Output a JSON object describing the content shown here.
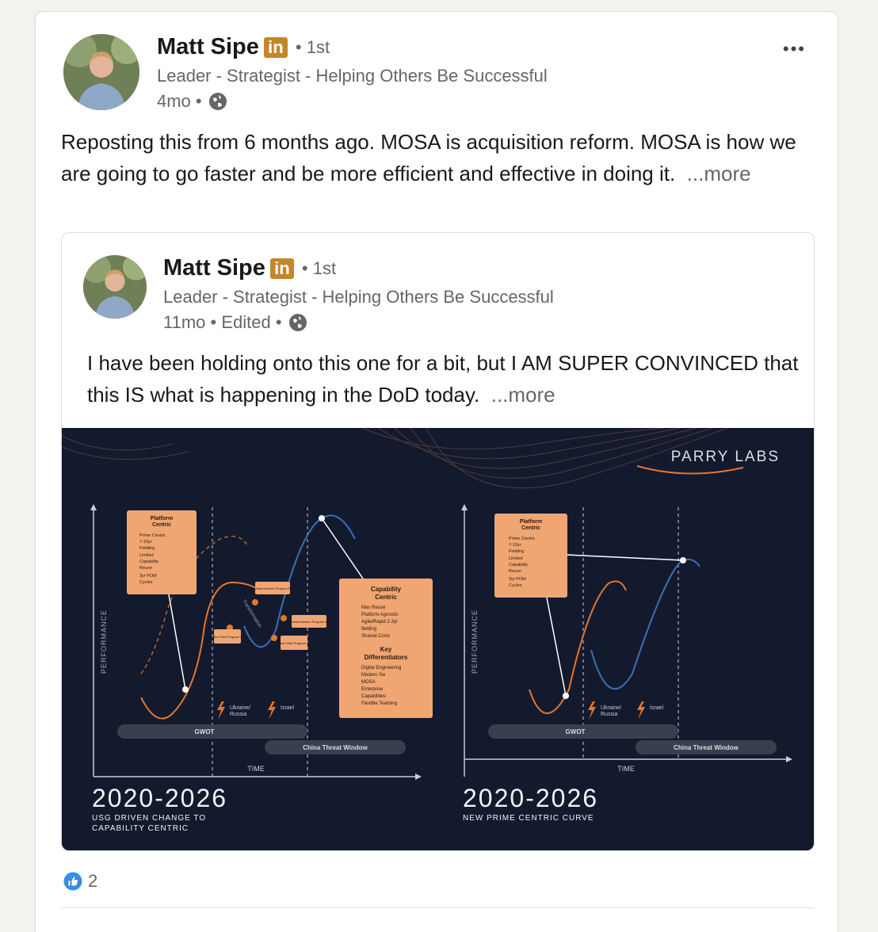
{
  "post": {
    "author": {
      "name": "Matt Sipe",
      "badge": "in",
      "degree": "• 1st",
      "headline": "Leader - Strategist - Helping Others Be Successful",
      "time": "4mo •"
    },
    "text": "Reposting this from 6 months ago. MOSA is acquisition reform. MOSA is how we are going to go faster and be more efficient and effective in doing it.",
    "see_more": "...more",
    "menu": "•••",
    "reaction_count": "2"
  },
  "repost": {
    "author": {
      "name": "Matt Sipe",
      "badge": "in",
      "degree": "• 1st",
      "headline": "Leader - Strategist - Helping Others Be Successful",
      "time": "11mo • Edited •"
    },
    "text": "I have been holding onto this one for a bit, but I AM SUPER CONVINCED that this IS what is happening in the DoD today.",
    "see_more": "...more"
  },
  "image": {
    "brand": "PARRY LABS",
    "left": {
      "ylabel": "PERFORMANCE",
      "xlabel": "TIME",
      "year": "2020-2026",
      "caption_1": "USG DRIVEN CHANGE TO",
      "caption_2": "CAPABILITY CENTRIC",
      "platform_title_1": "Platform",
      "platform_title_2": "Centric",
      "platform_items": [
        "Prime Centric",
        "7-10yr",
        "Fielding",
        "Limited",
        "Capability",
        "Reuse",
        "3yr POM",
        "Cycles"
      ],
      "capability_title_1": "Capability",
      "capability_title_2": "Centric",
      "capability_items": [
        "Max Reuse",
        "Platform Agnostic",
        "Agile/Rapid 2-3yr",
        "fielding",
        "Shared Costs"
      ],
      "diff_title_1": "Key",
      "diff_title_2": "Differentiators",
      "diff_items": [
        "Digital Engineering",
        "Modern Sw",
        "MOSA",
        "Enterprise",
        "Capabilities",
        "Flexible Teaming"
      ],
      "labels": {
        "modB": "Modernization Program B",
        "modA": "Modernization Program A",
        "nsA": "New Start Program A",
        "nsB": "New Start Program B",
        "transformation": "Transformation"
      },
      "ukraine_1": "Ukraine/",
      "ukraine_2": "Russia",
      "israel": "Israel",
      "gwot": "GWOT",
      "china": "China Threat Window"
    },
    "right": {
      "ylabel": "PERFORMANCE",
      "xlabel": "TIME",
      "year": "2020-2026",
      "caption_1": "NEW PRIME CENTRIC CURVE",
      "platform_title_1": "Platform",
      "platform_title_2": "Centric",
      "platform_items": [
        "Prime Centric",
        "7-10yr",
        "Fielding",
        "Limited",
        "Capability",
        "Reuse",
        "3yr POM",
        "Cycles"
      ],
      "ukraine_1": "Ukraine/",
      "ukraine_2": "Russia",
      "israel": "Israel",
      "gwot": "GWOT",
      "china": "China Threat Window"
    }
  },
  "colors": {
    "accent": "#c3862a",
    "orange": "#e4762c",
    "blue": "#3b6fb4",
    "box": "#f0a672",
    "navy": "#131a2e"
  }
}
